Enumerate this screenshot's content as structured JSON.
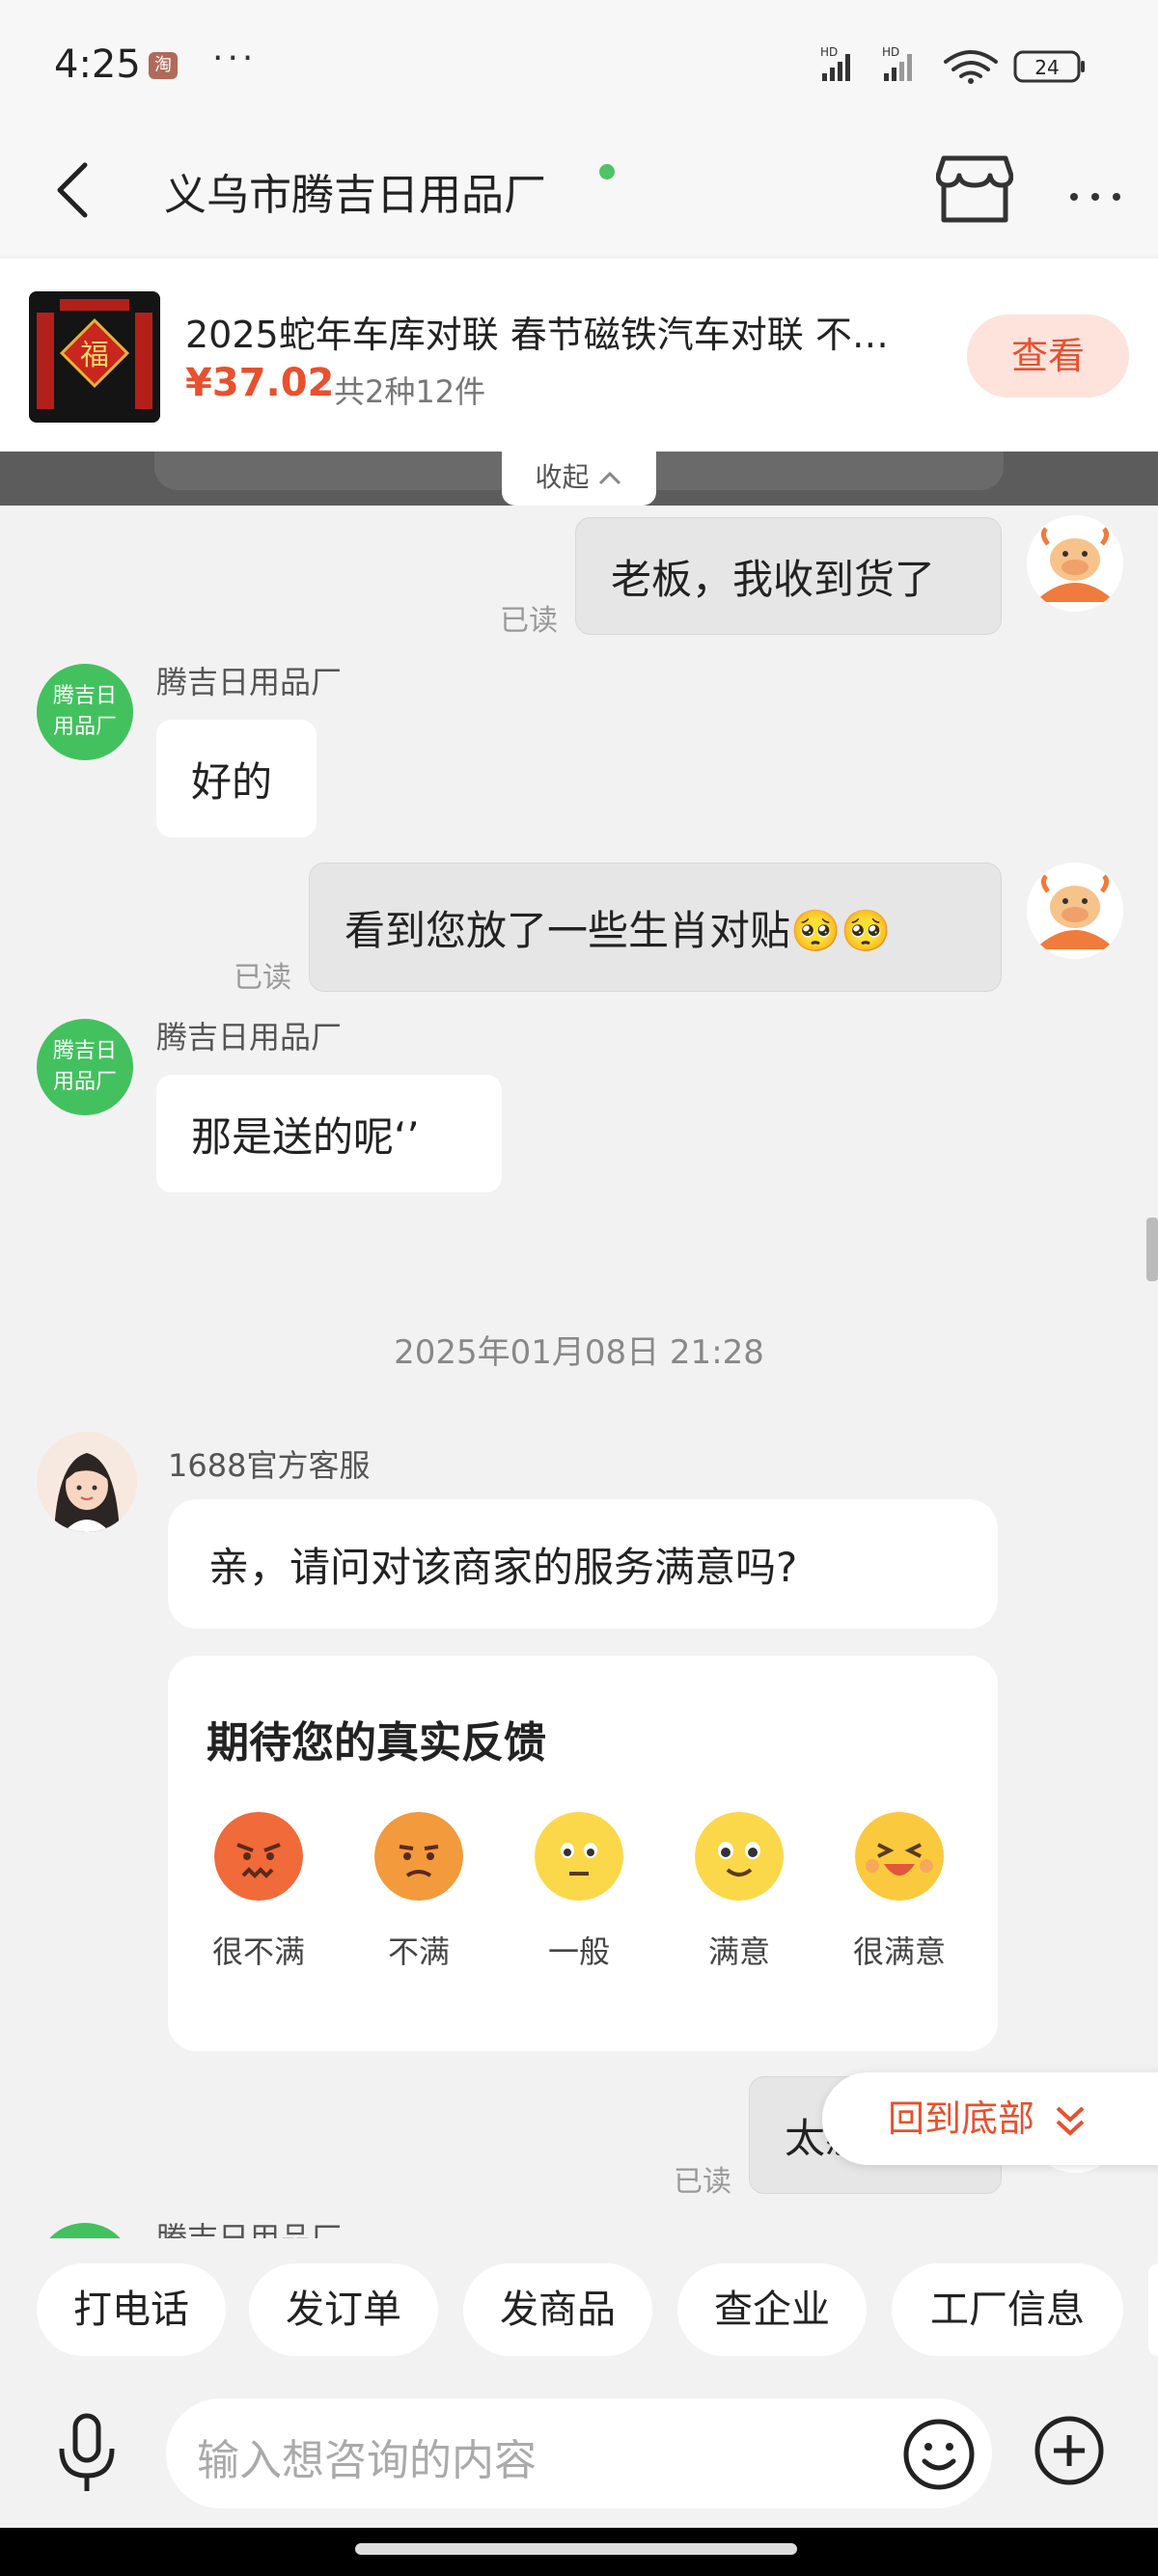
{
  "status_bar": {
    "time": "4:25",
    "app_badge": "淘",
    "more": "···",
    "network_1": "HD",
    "network_2": "HD",
    "battery": "24"
  },
  "header": {
    "title": "义乌市腾吉日用品厂",
    "online_color": "#4fc466"
  },
  "product": {
    "title": "2025蛇年车库对联 春节磁铁汽车对联 不…",
    "price": "¥37.02",
    "quantity": "共2种12件",
    "view_label": "查看",
    "thumb_character": "福"
  },
  "collapse_label": "收起",
  "messages": {
    "m1_text": "老板，我收到货了",
    "m1_status": "已读",
    "m2_sender": "腾吉日用品厂",
    "m2_avatar": [
      "腾吉日",
      "用品厂"
    ],
    "m2_text": "好的",
    "m3_text": "看到您放了一些生肖对贴🥺🥺",
    "m3_status": "已读",
    "m4_sender": "腾吉日用品厂",
    "m4_avatar": [
      "腾吉日",
      "用品厂"
    ],
    "m4_text": "那是送的呢‘’",
    "timestamp": "2025年01月08日 21:28",
    "m5_sender": "1688官方客服",
    "m5_text": "亲，请问对该商家的服务满意吗?",
    "m6_text": "太感谢了",
    "m6_status": "已读",
    "m7_sender": "腾吉日用品厂"
  },
  "feedback": {
    "title": "期待您的真实反馈",
    "options": [
      {
        "label": "很不满",
        "icon": "very-unsatisfied-face-icon",
        "color": "#f06a3a"
      },
      {
        "label": "不满",
        "icon": "unsatisfied-face-icon",
        "color": "#f29a3c"
      },
      {
        "label": "一般",
        "icon": "neutral-face-icon",
        "color": "#fbd84a"
      },
      {
        "label": "满意",
        "icon": "satisfied-face-icon",
        "color": "#fbd84a"
      },
      {
        "label": "很满意",
        "icon": "very-satisfied-face-icon",
        "color": "#fbc93e"
      }
    ]
  },
  "back_to_bottom": "回到底部",
  "quick_actions": [
    "打电话",
    "发订单",
    "发商品",
    "查企业",
    "工厂信息"
  ],
  "input": {
    "placeholder": "输入想咨询的内容"
  },
  "colors": {
    "accent": "#e8502e",
    "merchant_avatar": "#43c15e",
    "my_bubble": "#e6e6e6"
  }
}
